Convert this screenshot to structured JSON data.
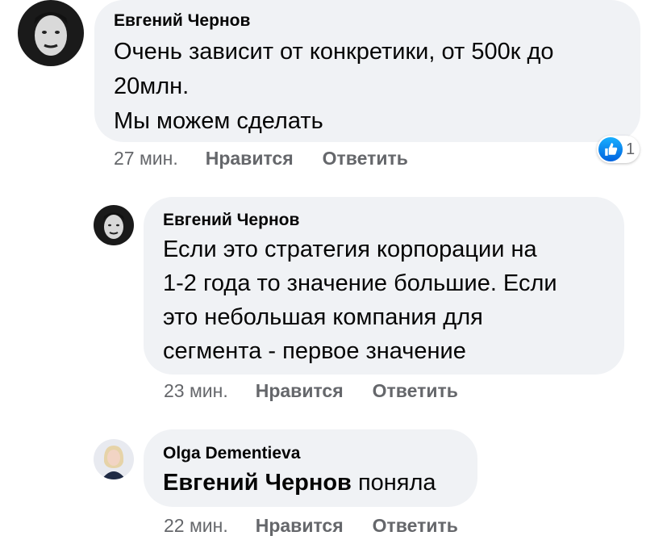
{
  "comments": [
    {
      "author": "Евгений Чернов",
      "lines": [
        "Очень зависит от конкретики, от 500к до",
        "20млн.",
        "Мы можем сделать"
      ],
      "time": "27 мин.",
      "like_label": "Нравится",
      "reply_label": "Ответить",
      "reaction_count": "1",
      "reaction_icon": "like-icon"
    },
    {
      "author": "Евгений Чернов",
      "lines": [
        "Если это стратегия корпорации на",
        "1-2 года то значение большие. Если",
        "это небольшая компания для",
        "сегмента - первое значение"
      ],
      "time": "23 мин.",
      "like_label": "Нравится",
      "reply_label": "Ответить"
    },
    {
      "author": "Olga Dementieva",
      "mention": "Евгений Чернов",
      "text": "поняла",
      "time": "22 мин.",
      "like_label": "Нравится",
      "reply_label": "Ответить"
    }
  ]
}
